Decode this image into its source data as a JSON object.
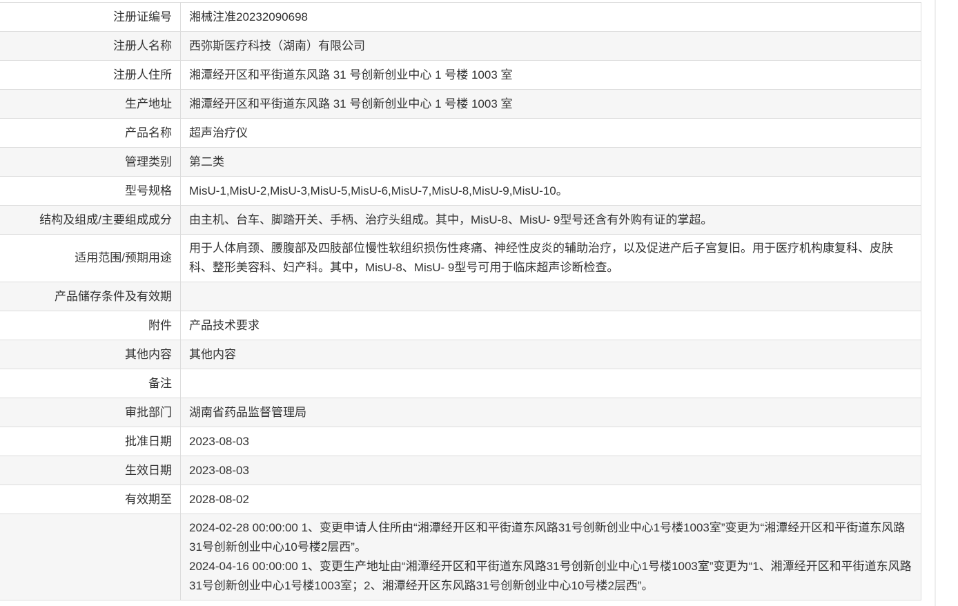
{
  "table": {
    "rows": [
      {
        "label": "注册证编号",
        "value": "湘械注准20232090698"
      },
      {
        "label": "注册人名称",
        "value": "西弥斯医疗科技（湖南）有限公司"
      },
      {
        "label": "注册人住所",
        "value": "湘潭经开区和平街道东风路 31 号创新创业中心 1 号楼 1003 室"
      },
      {
        "label": "生产地址",
        "value": "湘潭经开区和平街道东风路 31 号创新创业中心 1 号楼 1003 室"
      },
      {
        "label": "产品名称",
        "value": "超声治疗仪"
      },
      {
        "label": "管理类别",
        "value": "第二类"
      },
      {
        "label": "型号规格",
        "value": "MisU-1,MisU-2,MisU-3,MisU-5,MisU-6,MisU-7,MisU-8,MisU-9,MisU-10。"
      },
      {
        "label": "结构及组成/主要组成成分",
        "value": "由主机、台车、脚踏开关、手柄、治疗头组成。其中，MisU-8、MisU- 9型号还含有外购有证的掌超。"
      },
      {
        "label": "适用范围/预期用途",
        "value": "用于人体肩颈、腰腹部及四肢部位慢性软组织损伤性疼痛、神经性皮炎的辅助治疗，以及促进产后子宫复旧。用于医疗机构康复科、皮肤科、整形美容科、妇产科。其中，MisU-8、MisU- 9型号可用于临床超声诊断检查。"
      },
      {
        "label": "产品储存条件及有效期",
        "value": ""
      },
      {
        "label": "附件",
        "value": "产品技术要求"
      },
      {
        "label": "其他内容",
        "value": "其他内容"
      },
      {
        "label": "备注",
        "value": ""
      },
      {
        "label": "审批部门",
        "value": "湖南省药品监督管理局"
      },
      {
        "label": "批准日期",
        "value": "2023-08-03"
      },
      {
        "label": "生效日期",
        "value": "2023-08-03"
      },
      {
        "label": "有效期至",
        "value": "2028-08-02"
      }
    ],
    "change_history": {
      "label": "",
      "entries": [
        "2024-02-28 00:00:00 1、变更申请人住所由“湘潭经开区和平街道东风路31号创新创业中心1号楼1003室”变更为“湘潭经开区和平街道东风路31号创新创业中心10号楼2层西”。",
        "2024-04-16 00:00:00 1、变更生产地址由“湘潭经开区和平街道东风路31号创新创业中心1号楼1003室”变更为“1、湘潭经开区和平街道东风路31号创新创业中心1号楼1003室；2、湘潭经开区东风路31号创新创业中心10号楼2层西”。"
      ]
    }
  }
}
